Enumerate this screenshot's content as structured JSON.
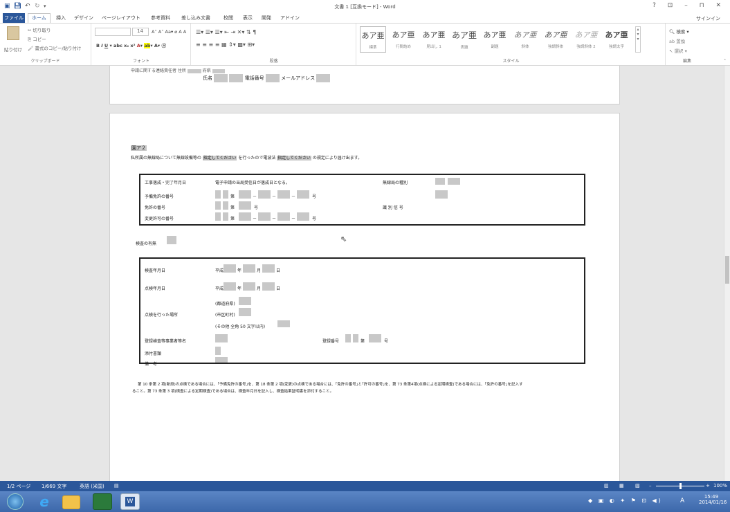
{
  "window": {
    "title": "文書 1 [互換モード] - Word",
    "controls": "? ⊡ – ⊓ ✕"
  },
  "tabs": [
    "ファイル",
    "ホーム",
    "挿入",
    "デザイン",
    "ページレイアウト",
    "参考資料",
    "差し込み文書",
    "校閲",
    "表示",
    "開発",
    "アドイン"
  ],
  "signin": "サインイン",
  "ribbon": {
    "clipboard": {
      "paste": "貼り付け",
      "cut": "切り取り",
      "copy": "コピー",
      "format_painter": "書式のコピー/貼り付け",
      "label": "クリップボード"
    },
    "font": {
      "size": "14",
      "label": "フォント"
    },
    "paragraph": {
      "label": "段落"
    },
    "styles": {
      "label": "スタイル",
      "items": [
        {
          "sample": "あア亜",
          "name": "標準"
        },
        {
          "sample": "あア亜",
          "name": "行間詰め"
        },
        {
          "sample": "あア亜",
          "name": "見出し 1"
        },
        {
          "sample": "あア亜",
          "name": "表題"
        },
        {
          "sample": "あア亜",
          "name": "副題"
        },
        {
          "sample": "あア亜",
          "name": "斜体"
        },
        {
          "sample": "あア亜",
          "name": "強調斜体"
        },
        {
          "sample": "あア亜",
          "name": "強調斜体 2"
        },
        {
          "sample": "あア亜",
          "name": "強調太字"
        }
      ]
    },
    "editing": {
      "find": "検索",
      "replace": "置換",
      "select": "選択",
      "label": "編集"
    }
  },
  "page1": {
    "line_partial": "申請に関する連絡責任者 住所",
    "line_partial_2": "府県",
    "name_label": "氏名",
    "phone_label": "電話番号",
    "email_label": "メールアドレス"
  },
  "page2": {
    "heading": "園ア２",
    "intro_1": "私所属の無線局について無線設備等の",
    "placeholder": "指定してください",
    "intro_2": "を行ったので電波法",
    "intro_3": "の規定により届け出ます。",
    "table1": {
      "completion_date": "工事落成・完了年月日",
      "completion_note": "電子申請の当局受信日が落成日となる。",
      "station_type": "無線局の種別",
      "prelicense_no": "予備免許の番号",
      "license_no": "免許の番号",
      "change_permit_no": "変更許可の番号",
      "dai": "第",
      "go": "号",
      "dash": "－",
      "callsign": "識 別 信 号"
    },
    "inspection_presence": "検査の有無",
    "table2": {
      "inspection_date": "検査年月日",
      "check_date": "点検年月日",
      "heisei": "平成",
      "year": "年",
      "month": "月",
      "day": "日",
      "place_label": "点検を行った場所",
      "prefecture": "(都道府県)",
      "city": "(市区町村)",
      "other": "(その他 全角 50 文字以内)",
      "inspector_name": "登録検査等事業者等名",
      "reg_no": "登録番号",
      "dai": "第",
      "go": "号",
      "attachments": "添付書類",
      "remarks": "備　考"
    },
    "footnote_1": "第 10 条第 2 項(新設)の点検である場合には、｢予備免許の番号｣を、第 18 条第 2 項(変更)の点検である場合には、｢免許の番号｣と｢許可の番号｣を、第 73 条第4項(点検による定期検査)である場合には、｢免許の番号｣を記入す",
    "footnote_2": "ること。第 73 条第 3 項(検査による定期検査)である場合は、検査年月日を記入し、検査結果証明書を添付すること。"
  },
  "status": {
    "page": "1/2 ページ",
    "words": "1/669 文字",
    "language": "英語 (米国)",
    "zoom": "100%"
  },
  "taskbar": {
    "ime": "A",
    "time": "15:49",
    "date": "2014/01/16"
  }
}
